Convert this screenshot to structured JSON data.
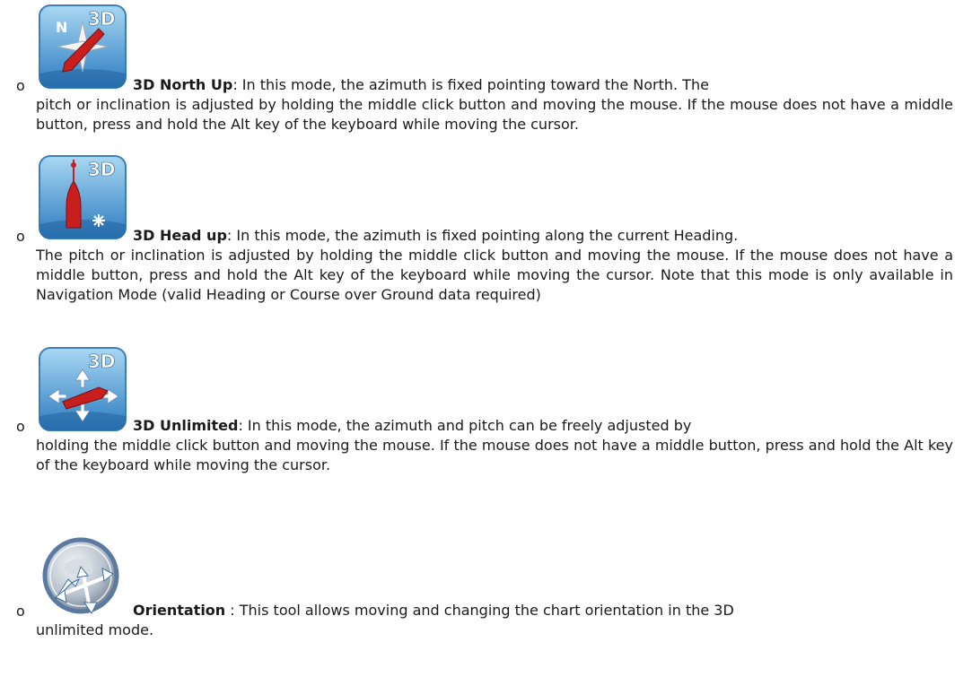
{
  "items": [
    {
      "icon": "3d-north-up-icon",
      "icon_label": "3D",
      "icon_north_label": "N",
      "term": "3D North Up",
      "sep": ":",
      "desc_first": " In this mode, the azimuth is fixed pointing toward the North. The",
      "desc_rest": "pitch or inclination is adjusted by holding the middle click button and moving the mouse. If the mouse does not have a middle button, press and hold the Alt key of the keyboard while moving the cursor."
    },
    {
      "icon": "3d-head-up-icon",
      "icon_label": "3D",
      "term": "3D Head up",
      "sep": ":",
      "desc_first": " In this mode, the azimuth is fixed pointing along the current Heading.",
      "desc_rest": "The pitch or inclination is adjusted by holding the middle click button and moving the mouse. If the mouse does not have a middle button, press and hold the Alt key of the keyboard while moving the cursor. Note that this mode is only available in Navigation Mode (valid Heading or Course over Ground data required)"
    },
    {
      "icon": "3d-unlimited-icon",
      "icon_label": "3D",
      "term": "3D Unlimited",
      "sep": ":",
      "desc_first": " In this mode, the azimuth and pitch can be freely adjusted by",
      "desc_rest": "holding the middle click button and moving the mouse. If the mouse does not have a middle button, press and hold the Alt key of the keyboard while moving the cursor."
    },
    {
      "icon": "orientation-icon",
      "term": "Orientation",
      "sep": " :",
      "desc_first": " This tool allows moving and changing the chart orientation in the 3D",
      "desc_rest": "unlimited mode."
    }
  ],
  "bullet": "o",
  "colors": {
    "icon_sea_top": "#9fd0ec",
    "icon_sea_bottom": "#2a7ec4",
    "icon_frame": "#3b7fb8",
    "boat_red": "#c81e1e",
    "label_white": "#ffffff"
  }
}
